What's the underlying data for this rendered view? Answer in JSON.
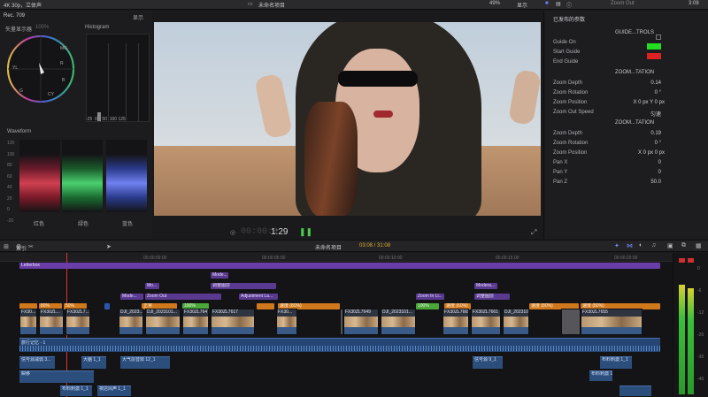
{
  "topbar": {
    "left": "4K 30p，立体声",
    "center": "未命名项目",
    "zoom": "49%",
    "display": "显示",
    "zoom_out": "Zoom Out",
    "timecode": "3:08"
  },
  "scopes": {
    "header": "Rec. 709",
    "header_right": "显示",
    "vectorscope": "矢量显示器",
    "vectorscope_extra": "100%",
    "histogram": "Histogram",
    "waveform": "Waveform",
    "vs_labels": [
      "R",
      "MG",
      "B",
      "CY",
      "G",
      "YL"
    ],
    "hist_axis": [
      "-25",
      "0",
      "50",
      "100",
      "125"
    ],
    "wave_axis": [
      "120",
      "100",
      "80",
      "60",
      "40",
      "20",
      "0",
      "-20"
    ],
    "wave_channels": [
      "红色",
      "绿色",
      "蓝色"
    ]
  },
  "controls": {
    "timecode": "1:29"
  },
  "inspector": {
    "title": "已发布的参数",
    "rows": [
      {
        "label": "GUIDE...TROLS",
        "value": ""
      },
      {
        "label": "Guide On",
        "value": ""
      },
      {
        "label": "Start Guide",
        "value": ""
      },
      {
        "label": "End Guide",
        "value": ""
      },
      {
        "label": "ZOOM...TATION",
        "value": ""
      },
      {
        "label": "Zoom Depth",
        "value": "0.14"
      },
      {
        "label": "Zoom Rotation",
        "value": "0 °"
      },
      {
        "label": "Zoom Position",
        "value": "X 0 px Y 0 px"
      },
      {
        "label": "Zoom Out Speed",
        "value": "匀速"
      },
      {
        "label": "ZOOM...TATION",
        "value": ""
      },
      {
        "label": "Zoom Depth",
        "value": "0.19"
      },
      {
        "label": "Zoom Rotation",
        "value": "0 °"
      },
      {
        "label": "Zoom Position",
        "value": "X 0 px 0 px"
      },
      {
        "label": "Pan X",
        "value": "0"
      },
      {
        "label": "Pan Y",
        "value": "0"
      },
      {
        "label": "Pan Z",
        "value": "50.0"
      }
    ],
    "start_color": "#22dd22",
    "end_color": "#dd2222"
  },
  "toolbar": {
    "index": "索引",
    "project": "未命名项目",
    "timecode": "03:08 / 31:08"
  },
  "timeline": {
    "ticks": [
      "00:00:00:00",
      "00:00:05:00",
      "00:00:10:00",
      "00:00:15:00",
      "00:00:20:00"
    ],
    "title_clip": "Letterbox",
    "gen_clips": [
      "Mode...",
      "Mo...",
      "Zoom Out",
      "调整图层",
      "Adjustment La...",
      "Zoom In Li...",
      "Modera...",
      "调整图层"
    ],
    "speed_labels": [
      "80% ",
      "50% ",
      "100% ",
      "正常",
      "100%",
      "速度 (80%)",
      "速度 (60%)",
      "速度 (80%)",
      "速度 (80%)"
    ],
    "video_clips": [
      "FX30...",
      "FX30ZL...",
      "FX30ZL7...",
      "DJI_2023...",
      "DJI_2023101...",
      "FX30ZL7647",
      "FX30ZL7617",
      "FX30...",
      "FX30ZL7649",
      "DJI_2023101...",
      "FX30ZL7669",
      "FX30ZL7661",
      "DJI_2023101...",
      "FX30ZL7655"
    ],
    "audio_main": "旅行记忆 - 1",
    "audio_clips": [
      "信号源减弱 3...",
      "大脑 1_1",
      "大气层音效 12_1",
      "信号源 9_1",
      "布料刺激 1_1",
      "瞬移",
      "布料刺激 1_1",
      "夜店风声 1_1",
      "布料刺激 1_1"
    ]
  },
  "meters": {
    "labels": [
      "0",
      "-6",
      "-12",
      "-20",
      "-30",
      "-40"
    ]
  }
}
